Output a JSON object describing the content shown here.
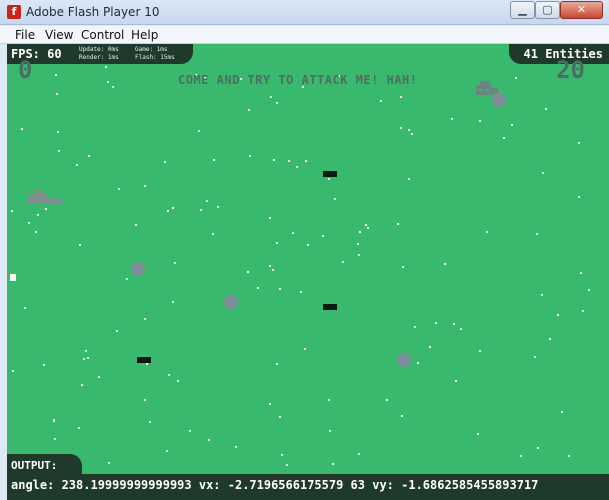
{
  "window": {
    "title": "Adobe Flash Player 10",
    "icon": "flash-player-icon",
    "buttons": {
      "minimize": "▁",
      "maximize": "▢",
      "close": "✕"
    }
  },
  "menu": {
    "items": [
      "File",
      "View",
      "Control",
      "Help"
    ]
  },
  "hud": {
    "fps": "FPS: 60",
    "update": "Update: 0ms",
    "render": "Render: 1ms",
    "game": "Game: 1ms",
    "flash": "Flash: 15ms",
    "entities": "41 Entities",
    "score_left": "0",
    "score_right": "20",
    "taunt": "COME AND TRY TO ATTACK ME! HAH!",
    "output_label": "OUTPUT:",
    "debug": "angle: 238.19999999999993 vx: -2.7196566175579 63 vy: -1.6862585455893717"
  },
  "colors": {
    "field": "#38b96e",
    "panel": "#1f3a2a",
    "star": "#e9f7ee",
    "asteroid": "#7f8d9a",
    "ship": "#7f8d8c",
    "bullet": "#0b1a12"
  }
}
